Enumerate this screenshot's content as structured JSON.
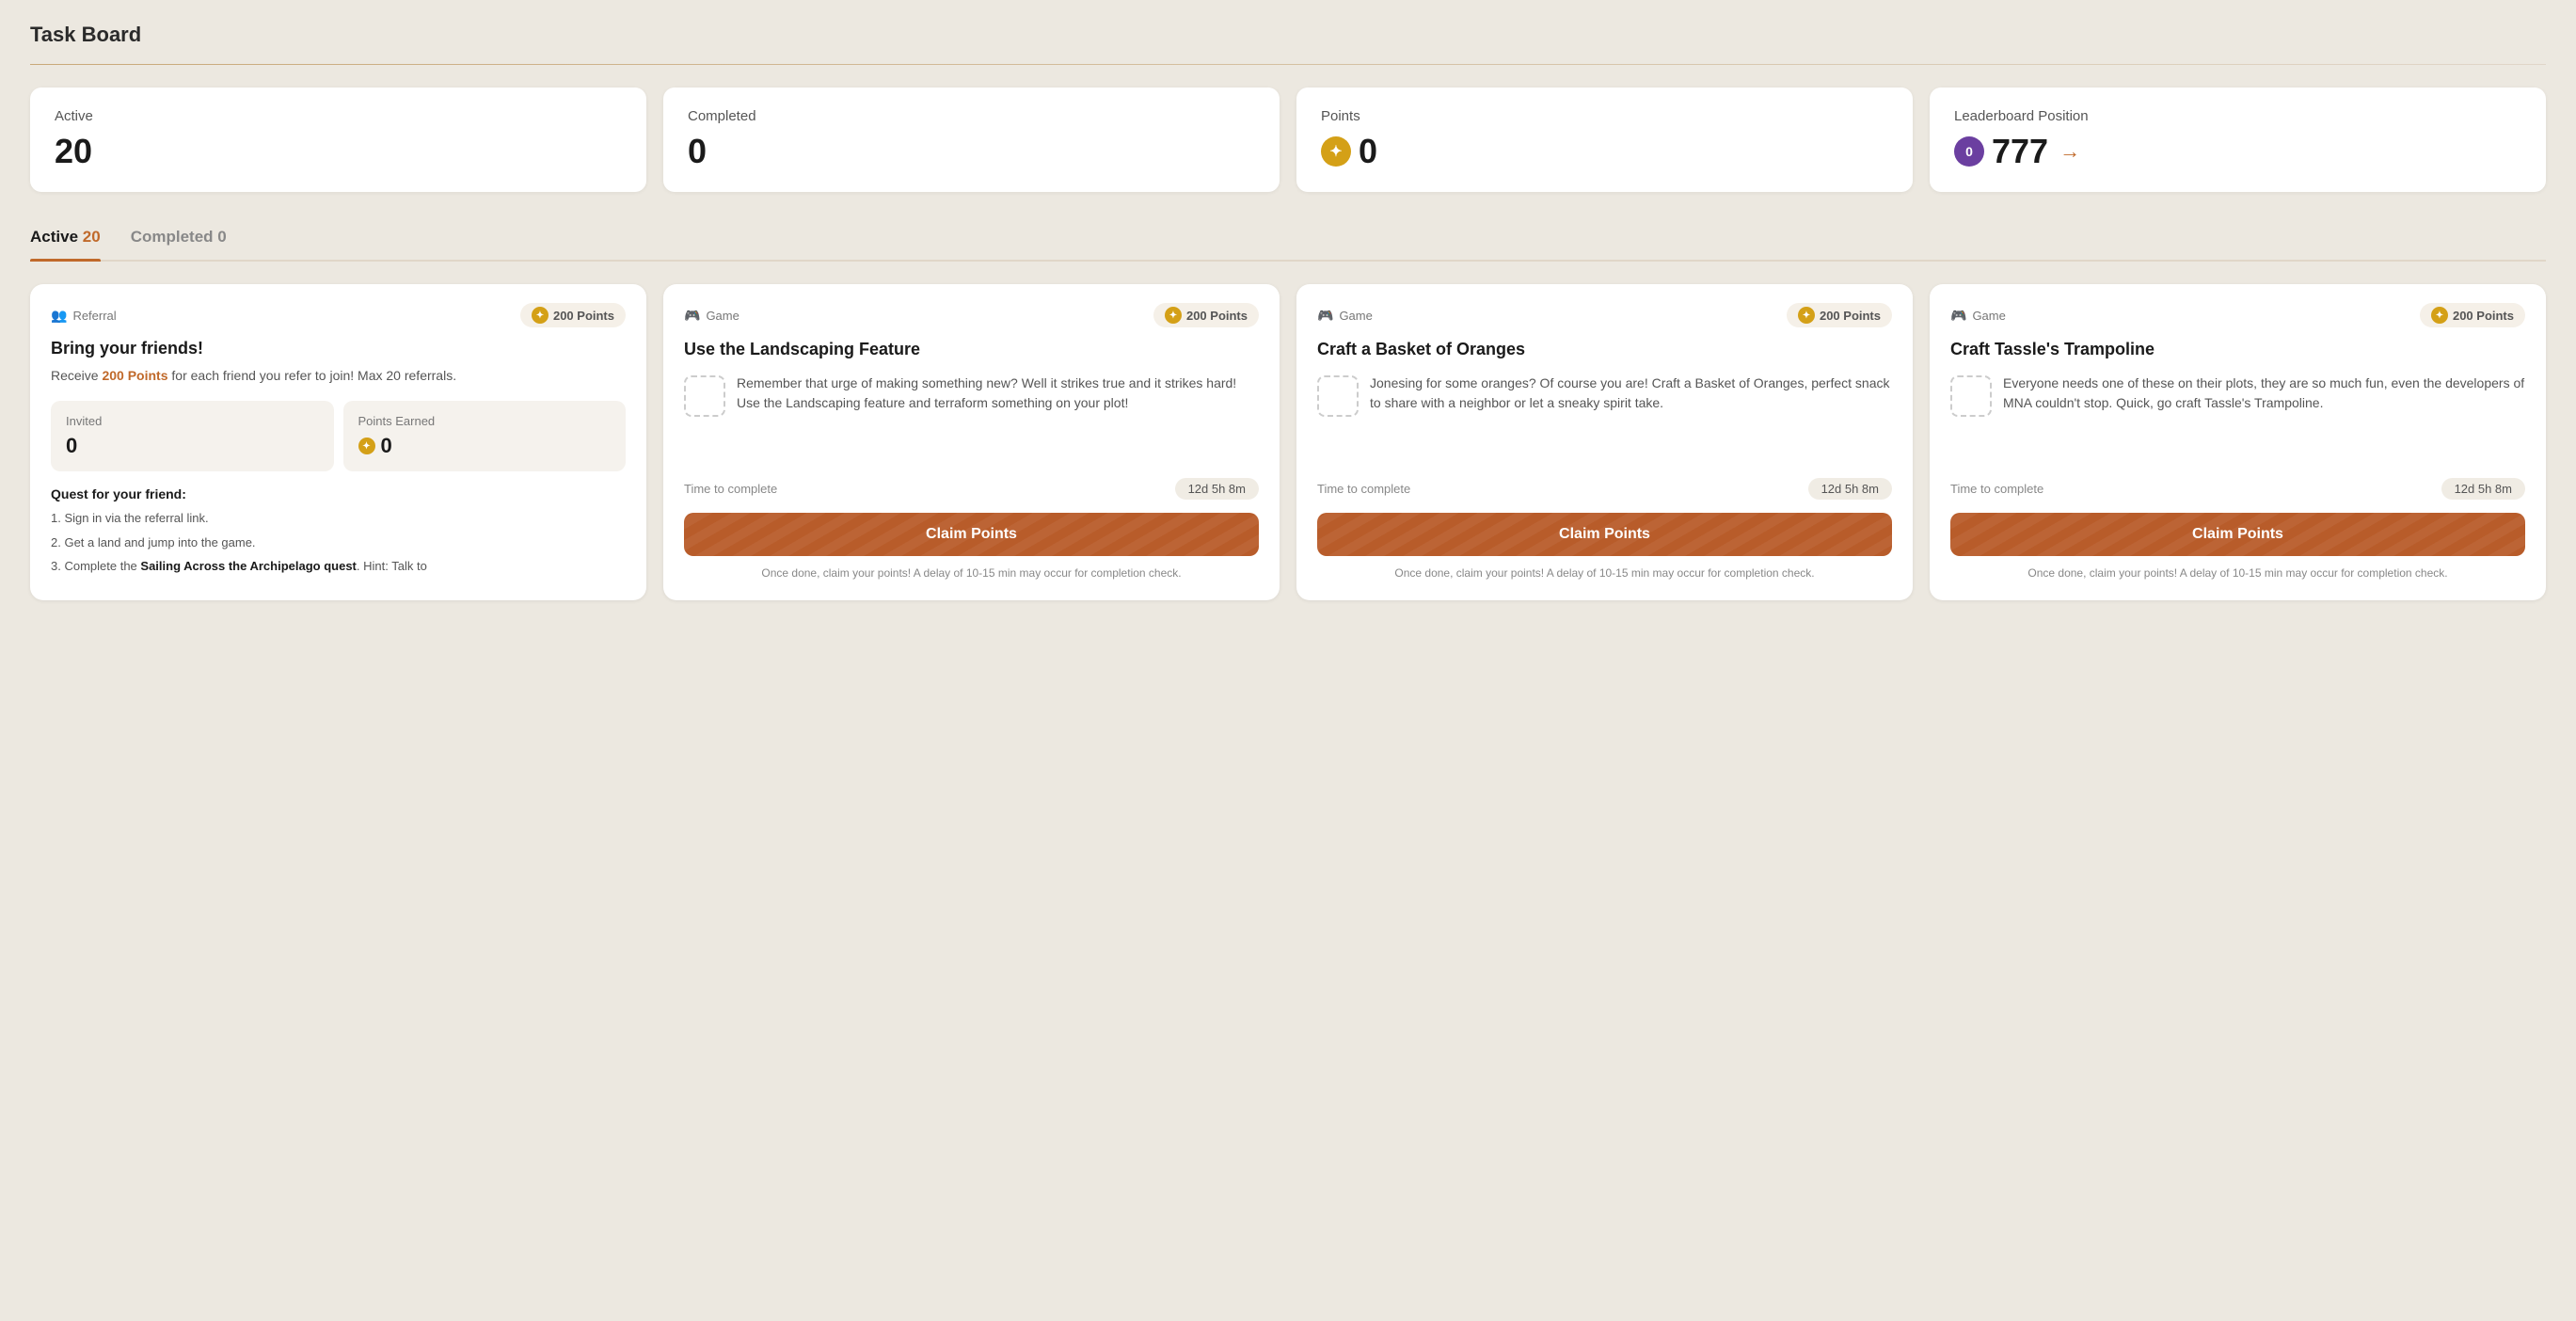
{
  "page": {
    "title": "Task Board"
  },
  "stats": [
    {
      "id": "active",
      "label": "Active",
      "value": "20",
      "icon": null
    },
    {
      "id": "completed",
      "label": "Completed",
      "value": "0",
      "icon": null
    },
    {
      "id": "points",
      "label": "Points",
      "value": "0",
      "icon": "points"
    },
    {
      "id": "leaderboard",
      "label": "Leaderboard Position",
      "value": "777",
      "icon": "leaderboard",
      "badge": "0"
    }
  ],
  "tabs": [
    {
      "id": "active",
      "label": "Active",
      "count": "20",
      "active": true
    },
    {
      "id": "completed",
      "label": "Completed",
      "count": "0",
      "active": false
    }
  ],
  "cards": [
    {
      "id": "referral",
      "type": "Referral",
      "type_icon": "👥",
      "points": "200 Points",
      "title": "Bring your friends!",
      "subtitle": "Receive 200 Points for each friend you refer to join! Max 20 referrals.",
      "invited_label": "Invited",
      "invited_value": "0",
      "points_earned_label": "Points Earned",
      "points_earned_value": "0",
      "quest_title": "Quest for your friend:",
      "quest_steps": [
        "Sign in via the referral link.",
        "Get a land and jump into the game.",
        "Complete the Sailing Across the Archipelago quest. Hint: Talk to"
      ],
      "quest_step3_bold": "Sailing Across the Archipelago quest",
      "is_referral": true
    },
    {
      "id": "landscaping",
      "type": "Game",
      "type_icon": "🎮",
      "points": "200 Points",
      "title": "Use the Landscaping Feature",
      "description": "Remember that urge of making something new? Well it strikes true and it strikes hard! Use the Landscaping feature and terraform something on your plot!",
      "time_label": "Time to complete",
      "time_value": "12d 5h 8m",
      "claim_label": "Claim Points",
      "claim_note": "Once done, claim your points! A delay of 10-15 min may occur for completion check.",
      "has_placeholder": true
    },
    {
      "id": "oranges",
      "type": "Game",
      "type_icon": "🎮",
      "points": "200 Points",
      "title": "Craft a Basket of Oranges",
      "description": "Jonesing for some oranges? Of course you are! Craft a Basket of Oranges, perfect snack to share with a neighbor or let a sneaky spirit take.",
      "time_label": "Time to complete",
      "time_value": "12d 5h 8m",
      "claim_label": "Claim Points",
      "claim_note": "Once done, claim your points! A delay of 10-15 min may occur for completion check.",
      "has_placeholder": true
    },
    {
      "id": "trampoline",
      "type": "Game",
      "type_icon": "🎮",
      "points": "200 Points",
      "title": "Craft Tassle's Trampoline",
      "description": "Everyone needs one of these on their plots, they are so much fun, even the developers of MNA couldn't stop. Quick, go craft Tassle's Trampoline.",
      "time_label": "Time to complete",
      "time_value": "12d 5h 8m",
      "claim_label": "Claim Points",
      "claim_note": "Once done, claim your points! A delay of 10-15 min may occur for completion check.",
      "has_placeholder": true
    }
  ],
  "icons": {
    "star": "✦",
    "arrow_right": "→"
  }
}
